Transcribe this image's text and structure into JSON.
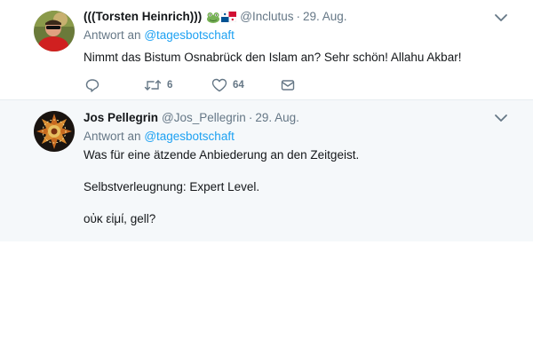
{
  "tweets": [
    {
      "name": "(((Torsten Heinrich)))",
      "handle": "@Inclutus",
      "separator": "·",
      "date": "29. Aug.",
      "reply_prefix": "Antwort an",
      "reply_mention": "@tagesbotschaft",
      "text": [
        "Nimmt das Bistum Osnabrück den Islam an? Sehr schön! Allahu Akbar!"
      ],
      "actions": {
        "reply_count": "",
        "retweet_count": "6",
        "like_count": "64"
      },
      "emoji": [
        "frog-emoji",
        "panama-flag-emoji"
      ]
    },
    {
      "name": "Jos Pellegrin",
      "handle": "@Jos_Pellegrin",
      "separator": "·",
      "date": "29. Aug.",
      "reply_prefix": "Antwort an",
      "reply_mention": "@tagesbotschaft",
      "text": [
        "Was für eine ätzende Anbiederung an den Zeitgeist.",
        "Selbstverleugnung: Expert Level.",
        "οὐκ εἰμί, gell?"
      ]
    }
  ],
  "colors": {
    "accent": "#1da1f2",
    "secondary_text": "#657786",
    "primary_text": "#14171a",
    "highlight_bg": "#f5f8fa"
  }
}
